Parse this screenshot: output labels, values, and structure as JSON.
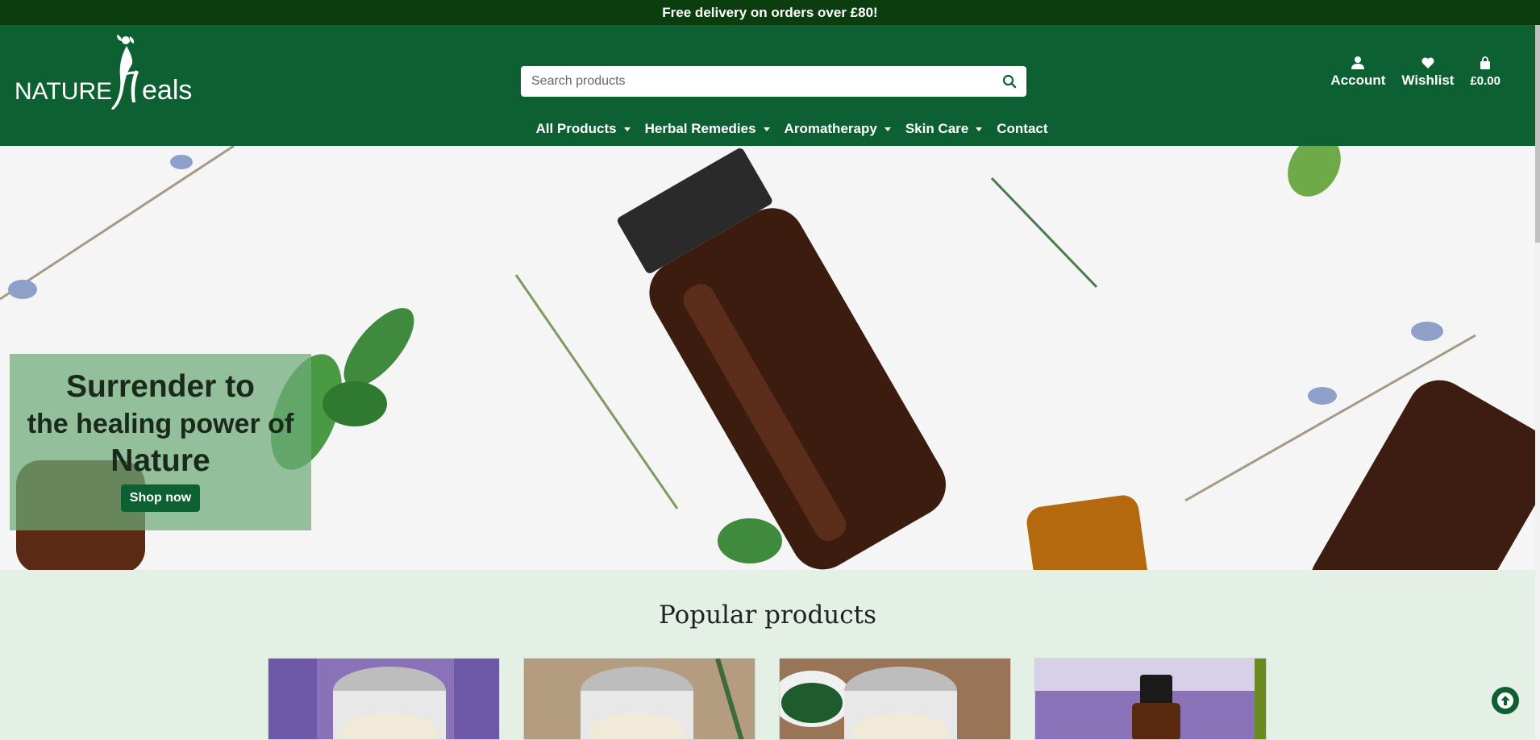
{
  "topbar": {
    "message": "Free delivery on orders over £80!"
  },
  "brand": {
    "name_part1": "NATURE",
    "name_part2": "eals",
    "accent": "#0c6032",
    "dark": "#0c3d0e"
  },
  "search": {
    "placeholder": "Search products",
    "icon": "search-icon"
  },
  "header_actions": [
    {
      "label": "Account",
      "icon": "user-icon"
    },
    {
      "label": "Wishlist",
      "icon": "heart-icon"
    },
    {
      "label": "£0.00",
      "icon": "shopping-bag-icon"
    }
  ],
  "nav": [
    {
      "label": "All Products",
      "dropdown": true
    },
    {
      "label": "Herbal Remedies",
      "dropdown": true
    },
    {
      "label": "Aromatherapy",
      "dropdown": true
    },
    {
      "label": "Skin Care",
      "dropdown": true
    },
    {
      "label": "Contact",
      "dropdown": false
    }
  ],
  "hero": {
    "line1": "Surrender to",
    "line2": "the healing power of",
    "line3": "Nature",
    "cta": "Shop now"
  },
  "popular": {
    "title": "Popular products",
    "products": [
      {
        "image": "lavender-cream-jar"
      },
      {
        "image": "rosemary-cream-jar"
      },
      {
        "image": "spirulina-cream-jar"
      },
      {
        "image": "lavender-oil-bottle"
      }
    ]
  },
  "back_to_top": {
    "icon": "arrow-up-icon"
  }
}
